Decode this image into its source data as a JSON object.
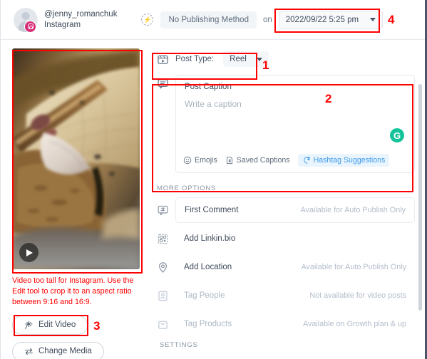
{
  "header": {
    "account_handle": "@jenny_romanchuk",
    "network": "Instagram",
    "network_icon": "instagram-icon",
    "publish_icon": "auto-publish-bolt-icon",
    "publishing_method": "No Publishing Method",
    "on_label": "on",
    "scheduled_date": "2022/09/22 5:25 pm",
    "date_caret_icon": "chevron-down-icon"
  },
  "media": {
    "play_icon": "play-icon",
    "warning": "Video too tall for Instagram. Use the Edit tool to crop it to an aspect ratio between 9:16 and 16:9.",
    "edit_button": "Edit Video",
    "edit_icon": "magic-wand-icon",
    "change_button": "Change Media",
    "change_icon": "swap-arrows-icon"
  },
  "post_type": {
    "icon": "reel-icon",
    "label": "Post Type:",
    "value": "Reel",
    "caret_icon": "chevron-down-icon"
  },
  "caption": {
    "icon": "comment-icon",
    "title": "Post Caption",
    "placeholder": "Write a caption",
    "value": "",
    "grammarly_icon": "grammarly-icon",
    "grammarly_glyph": "G",
    "tools": [
      {
        "label": "Emojis",
        "icon": "emoji-smiley-icon",
        "highlighted": false
      },
      {
        "label": "Saved Captions",
        "icon": "saved-captions-icon",
        "highlighted": false
      },
      {
        "label": "Hashtag Suggestions",
        "icon": "hashtag-icon",
        "highlighted": true
      }
    ]
  },
  "more_options": {
    "section_label": "MORE OPTIONS",
    "rows": [
      {
        "label": "First Comment",
        "note": "Available for Auto Publish Only",
        "icon": "hashtag-comment-icon",
        "boxed": true,
        "muted": false
      },
      {
        "label": "Add Linkin.bio",
        "note": "",
        "icon": "linkinbio-qr-icon",
        "boxed": false,
        "muted": false
      },
      {
        "label": "Add Location",
        "note": "Available for Auto Publish Only",
        "icon": "location-pin-icon",
        "boxed": false,
        "muted": false
      },
      {
        "label": "Tag People",
        "note": "Not available for video posts",
        "icon": "tag-person-icon",
        "boxed": false,
        "muted": true
      },
      {
        "label": "Tag Products",
        "note": "Available on Growth plan & up",
        "icon": "shopping-bag-icon",
        "boxed": false,
        "muted": true
      }
    ]
  },
  "settings": {
    "section_label": "SETTINGS"
  },
  "annotations": [
    {
      "number": "1"
    },
    {
      "number": "2"
    },
    {
      "number": "3"
    },
    {
      "number": "4"
    }
  ],
  "colors": {
    "accent_red": "#ff0000",
    "instagram_pink": "#d62976",
    "grammarly_green": "#15c39a",
    "hashtag_blue": "#3d9be9"
  }
}
